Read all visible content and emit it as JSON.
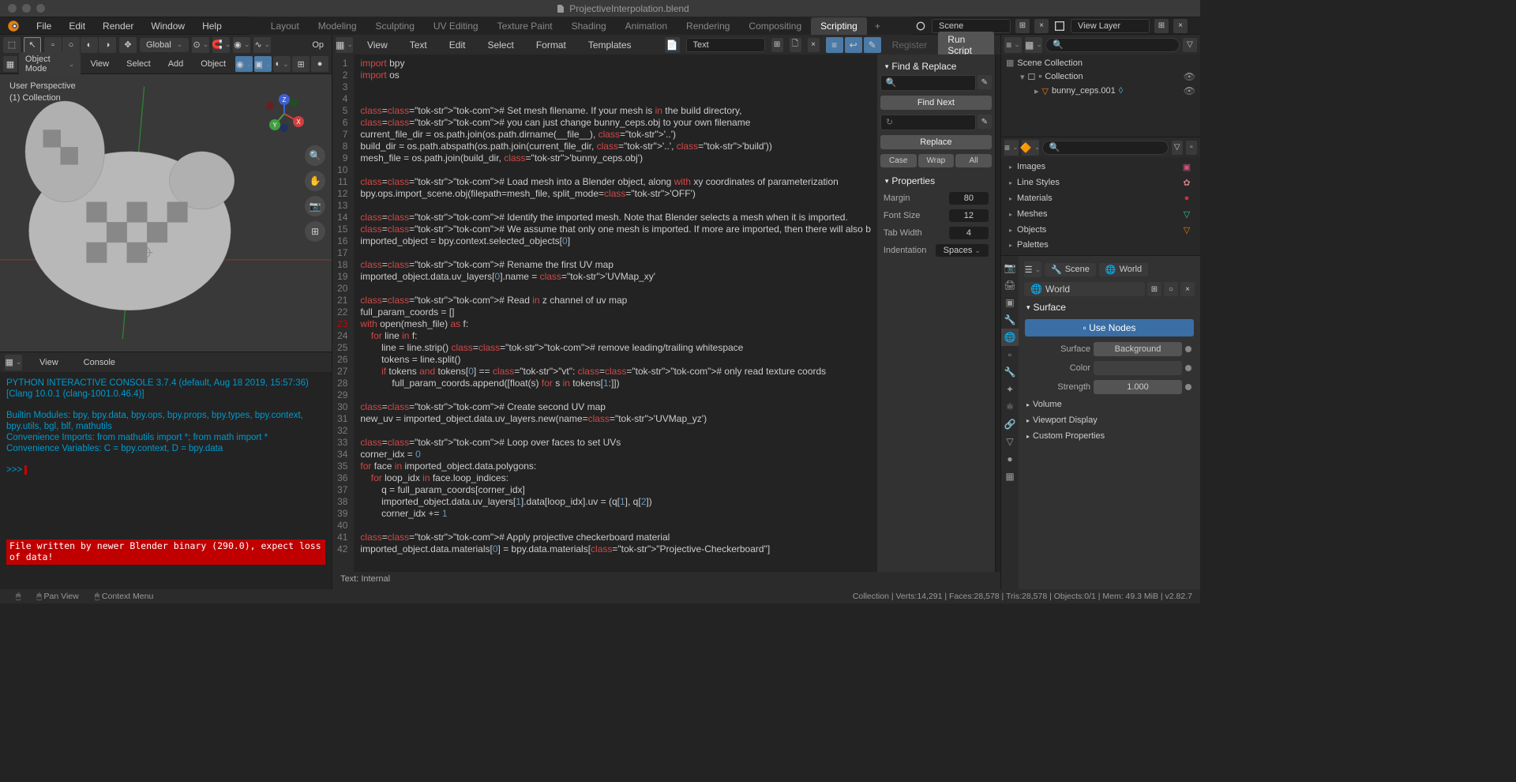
{
  "titlebar": {
    "filename": "ProjectiveInterpolation.blend"
  },
  "menubar": [
    "File",
    "Edit",
    "Render",
    "Window",
    "Help"
  ],
  "workspaces": {
    "tabs": [
      "Layout",
      "Modeling",
      "Sculpting",
      "UV Editing",
      "Texture Paint",
      "Shading",
      "Animation",
      "Rendering",
      "Compositing",
      "Scripting"
    ],
    "active": "Scripting"
  },
  "scene_layer": {
    "scene": "Scene",
    "view_layer": "View Layer"
  },
  "viewport3d": {
    "header1": {
      "orientation": "Global",
      "options_btn": "Op"
    },
    "header2": {
      "mode": "Object Mode",
      "menus": [
        "View",
        "Select",
        "Add",
        "Object"
      ]
    },
    "overlay": {
      "line1": "User Perspective",
      "line2": "(1) Collection"
    }
  },
  "console": {
    "header_menus": [
      "View",
      "Console"
    ],
    "lines": [
      {
        "cls": "cyan",
        "text": "PYTHON INTERACTIVE CONSOLE 3.7.4 (default, Aug 18 2019, 15:57:36)  [Clang 10.0.1 (clang-1001.0.46.4)]"
      },
      {
        "cls": "cyan",
        "text": ""
      },
      {
        "cls": "cyan",
        "text": "Builtin Modules:       bpy, bpy.data, bpy.ops, bpy.props, bpy.types, bpy.context, bpy.utils, bgl, blf, mathutils"
      },
      {
        "cls": "cyan",
        "text": "Convenience Imports:   from mathutils import *; from math import *"
      },
      {
        "cls": "cyan",
        "text": "Convenience Variables: C = bpy.context, D = bpy.data"
      },
      {
        "cls": "cyan",
        "text": ""
      }
    ],
    "prompt": ">>> ",
    "error": "File written by newer Blender binary (290.0), expect loss of data!"
  },
  "text_editor": {
    "header_menus": [
      "View",
      "Text",
      "Edit",
      "Select",
      "Format",
      "Templates"
    ],
    "text_name": "Text",
    "register": "Register",
    "run_script": "Run Script",
    "footer": "Text: Internal",
    "active_line": 23,
    "code": [
      "import bpy",
      "import os",
      "",
      "",
      "# Set mesh filename. If your mesh is in the build directory,",
      "# you can just change bunny_ceps.obj to your own filename",
      "current_file_dir = os.path.join(os.path.dirname(__file__), '..')",
      "build_dir = os.path.abspath(os.path.join(current_file_dir, '..', 'build'))",
      "mesh_file = os.path.join(build_dir, 'bunny_ceps.obj')",
      "",
      "# Load mesh into a Blender object, along with xy coordinates of parameterization",
      "bpy.ops.import_scene.obj(filepath=mesh_file, split_mode='OFF')",
      "",
      "# Identify the imported mesh. Note that Blender selects a mesh when it is imported.",
      "# We assume that only one mesh is imported. If more are imported, then there will also b",
      "imported_object = bpy.context.selected_objects[0]",
      "",
      "# Rename the first UV map",
      "imported_object.data.uv_layers[0].name = 'UVMap_xy'",
      "",
      "# Read in z channel of uv map",
      "full_param_coords = []",
      "with open(mesh_file) as f:",
      "    for line in f:",
      "        line = line.strip() # remove leading/trailing whitespace",
      "        tokens = line.split()",
      "        if tokens and tokens[0] == \"vt\": # only read texture coords",
      "            full_param_coords.append([float(s) for s in tokens[1:]])",
      "",
      "# Create second UV map",
      "new_uv = imported_object.data.uv_layers.new(name='UVMap_yz')",
      "",
      "# Loop over faces to set UVs",
      "corner_idx = 0",
      "for face in imported_object.data.polygons:",
      "    for loop_idx in face.loop_indices:",
      "        q = full_param_coords[corner_idx]",
      "        imported_object.data.uv_layers[1].data[loop_idx].uv = (q[1], q[2])",
      "        corner_idx += 1",
      "",
      "# Apply projective checkerboard material",
      "imported_object.data.materials[0] = bpy.data.materials[\"Projective-Checkerboard\"]"
    ]
  },
  "find_replace": {
    "title": "Find & Replace",
    "find_next": "Find Next",
    "replace": "Replace",
    "btns": [
      "Case",
      "Wrap",
      "All"
    ],
    "props_title": "Properties",
    "margin_label": "Margin",
    "margin": "80",
    "fontsize_label": "Font Size",
    "fontsize": "12",
    "tabwidth_label": "Tab Width",
    "tabwidth": "4",
    "indent_label": "Indentation",
    "indent": "Spaces"
  },
  "outliner": {
    "scene_collection": "Scene Collection",
    "collection": "Collection",
    "object": "bunny_ceps.001"
  },
  "browser": {
    "items": [
      "Images",
      "Line Styles",
      "Materials",
      "Meshes",
      "Objects",
      "Palettes"
    ]
  },
  "properties": {
    "breadcrumb": [
      "Scene",
      "World"
    ],
    "world_name": "World",
    "surface_title": "Surface",
    "use_nodes": "Use Nodes",
    "surface_label": "Surface",
    "surface_val": "Background",
    "color_label": "Color",
    "strength_label": "Strength",
    "strength_val": "1.000",
    "sections": [
      "Volume",
      "Viewport Display",
      "Custom Properties"
    ]
  },
  "status": {
    "hints": [
      "Pan View",
      "Context Menu"
    ],
    "right": "Collection | Verts:14,291 | Faces:28,578 | Tris:28,578 | Objects:0/1 | Mem: 49.3 MiB | v2.82.7"
  }
}
